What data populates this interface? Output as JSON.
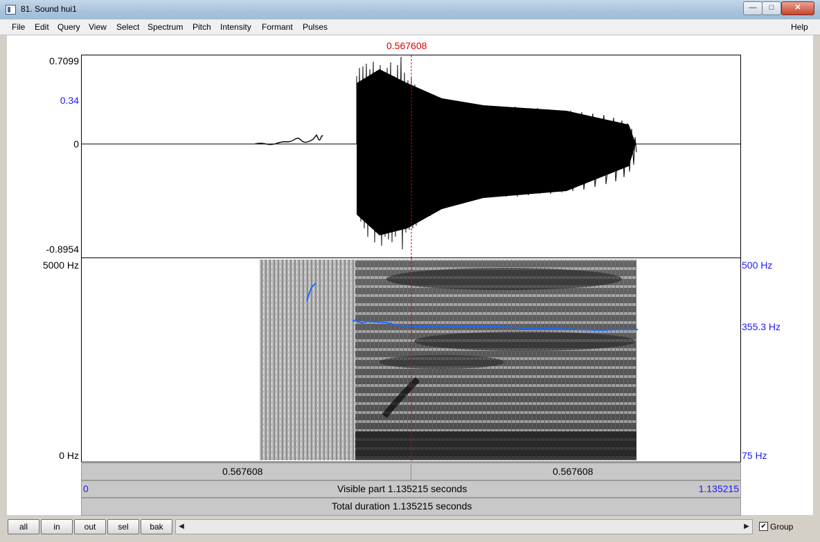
{
  "window": {
    "title": "81. Sound hui1",
    "controls": {
      "minimize": "—",
      "maximize": "□",
      "close": "✕"
    }
  },
  "menu": [
    "File",
    "Edit",
    "Query",
    "View",
    "Select",
    "Spectrum",
    "Pitch",
    "Intensity",
    "Formant",
    "Pulses"
  ],
  "help_label": "Help",
  "cursor_time": "0.567608",
  "waveform": {
    "max_label": "0.7099",
    "mid_label": "0.34",
    "zero_label": "0",
    "min_label": "-0.8954"
  },
  "spectrogram": {
    "top_freq": "5000 Hz",
    "bottom_freq": "0 Hz",
    "pitch_top": "500 Hz",
    "pitch_current": "355.3 Hz",
    "pitch_bottom": "75 Hz"
  },
  "time_bars": {
    "left_part": "0.567608",
    "right_part": "0.567608",
    "visible_start": "0",
    "visible_text": "Visible part 1.135215 seconds",
    "visible_end": "1.135215",
    "total_text": "Total duration 1.135215 seconds"
  },
  "buttons": {
    "all": "all",
    "in": "in",
    "out": "out",
    "sel": "sel",
    "bak": "bak"
  },
  "scroll_arrows": {
    "left": "◀",
    "right": "▶"
  },
  "group": {
    "checked": true,
    "mark": "✔",
    "label": "Group"
  },
  "colors": {
    "cursor": "#e00000",
    "pitch_curve": "#1a6aff",
    "axis_blue": "#1a1aff"
  }
}
